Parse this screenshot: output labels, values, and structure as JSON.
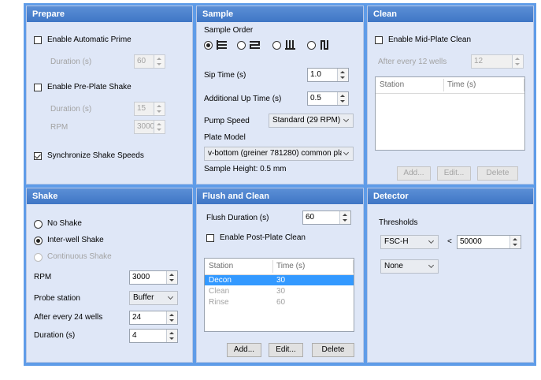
{
  "prepare": {
    "title": "Prepare",
    "auto_prime_label": "Enable Automatic Prime",
    "duration_label": "Duration (s)",
    "duration_value": "60",
    "pre_plate_shake_label": "Enable Pre-Plate Shake",
    "shake_duration_label": "Duration (s)",
    "shake_duration_value": "15",
    "rpm_label": "RPM",
    "rpm_value": "3000",
    "sync_label": "Synchronize Shake Speeds"
  },
  "sample": {
    "title": "Sample",
    "order_label": "Sample Order",
    "sip_time_label": "Sip Time (s)",
    "sip_time_value": "1.0",
    "up_time_label": "Additional Up Time (s)",
    "up_time_value": "0.5",
    "pump_speed_label": "Pump Speed",
    "pump_speed_value": "Standard (29 RPM)",
    "plate_model_label": "Plate Model",
    "plate_model_value": "v-bottom (greiner 781280) common pla",
    "sample_height_text": "Sample Height: 0.5 mm"
  },
  "clean": {
    "title": "Clean",
    "mid_plate_label": "Enable Mid-Plate Clean",
    "after_every_label": "After every 12 wells",
    "after_every_value": "12",
    "col_station": "Station",
    "col_time": "Time (s)",
    "add_label": "Add...",
    "edit_label": "Edit...",
    "delete_label": "Delete"
  },
  "shake": {
    "title": "Shake",
    "no_shake": "No Shake",
    "inter_well": "Inter-well Shake",
    "continuous": "Continuous Shake",
    "rpm_label": "RPM",
    "rpm_value": "3000",
    "probe_label": "Probe station",
    "probe_value": "Buffer",
    "after_every_label": "After every 24 wells",
    "after_every_value": "24",
    "duration_label": "Duration (s)",
    "duration_value": "4"
  },
  "flush": {
    "title": "Flush and Clean",
    "duration_label": "Flush Duration (s)",
    "duration_value": "60",
    "post_plate_label": "Enable Post-Plate Clean",
    "col_station": "Station",
    "col_time": "Time (s)",
    "rows": [
      {
        "station": "Decon",
        "time": "30"
      },
      {
        "station": "Clean",
        "time": "30"
      },
      {
        "station": "Rinse",
        "time": "60"
      }
    ],
    "add_label": "Add...",
    "edit_label": "Edit...",
    "delete_label": "Delete"
  },
  "detector": {
    "title": "Detector",
    "thresholds_label": "Thresholds",
    "channel_value": "FSC-H",
    "operator": "<",
    "threshold_value": "50000",
    "second_value": "None"
  }
}
